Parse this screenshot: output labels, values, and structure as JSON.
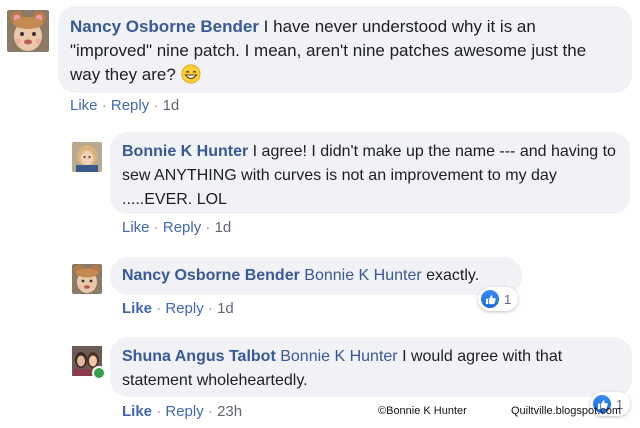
{
  "comments": [
    {
      "author": "Nancy Osborne Bender",
      "mention": "",
      "text": " I have never understood why it is an \"improved\" nine patch. I mean, aren't nine patches awesome just the way they are? ",
      "emoji": "grinning-face-emoji",
      "actions": {
        "like": "Like",
        "reply": "Reply",
        "time": "1d"
      }
    },
    {
      "author": "Bonnie K Hunter",
      "mention": "",
      "text": " I agree! I didn't make up the name --- and having to sew ANYTHING with curves is not an improvement to my day .....EVER. LOL",
      "actions": {
        "like": "Like",
        "reply": "Reply",
        "time": "1d"
      }
    },
    {
      "author": "Nancy Osborne Bender",
      "mention": "Bonnie K Hunter",
      "text": " exactly.",
      "reaction": {
        "icon": "like-icon",
        "count": "1"
      },
      "actions": {
        "like": "Like",
        "reply": "Reply",
        "time": "1d"
      }
    },
    {
      "author": "Shuna Angus Talbot",
      "mention": "Bonnie K Hunter",
      "text": " I would agree with that statement wholeheartedly.",
      "online": true,
      "reaction": {
        "icon": "like-icon",
        "count": "1"
      },
      "actions": {
        "like": "Like",
        "reply": "Reply",
        "time": "23h"
      }
    }
  ],
  "watermark": {
    "left": "©Bonnie K Hunter",
    "right": "Quiltville.blogspot.com"
  },
  "colors": {
    "author": "#385898",
    "action": "#4267b2",
    "bubble": "#f0f2f5",
    "like": "#1877f2",
    "online": "#31a24c"
  }
}
